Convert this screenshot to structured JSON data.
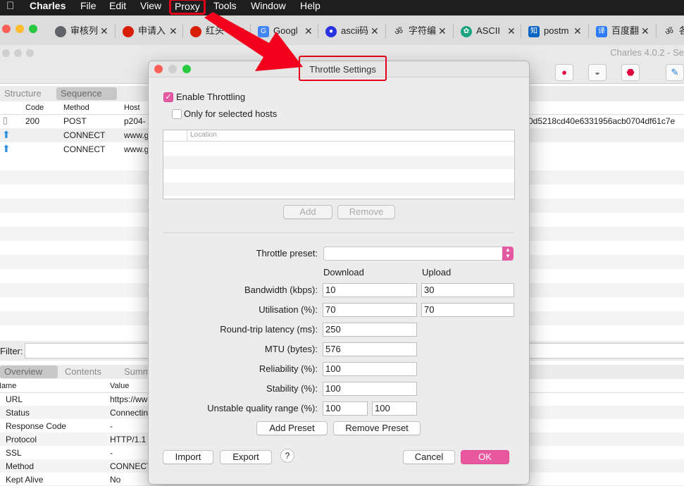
{
  "menubar": {
    "apple": "",
    "app_name": "Charles",
    "items": [
      "File",
      "Edit",
      "View",
      "Proxy",
      "Tools",
      "Window",
      "Help"
    ]
  },
  "browser_tabs": [
    {
      "title": "审核列",
      "icon": "globe-icon"
    },
    {
      "title": "申请入",
      "icon": "red-round-icon"
    },
    {
      "title": "红头",
      "icon": "red-round-icon"
    },
    {
      "title": "Googl",
      "icon": "google-translate-icon"
    },
    {
      "title": "ascii码",
      "icon": "baidu-paw-icon"
    },
    {
      "title": "字符编",
      "icon": "om-icon"
    },
    {
      "title": "ASCII",
      "icon": "openai-icon"
    },
    {
      "title": "postm",
      "icon": "zhihu-icon"
    },
    {
      "title": "百度翻",
      "icon": "fanyi-icon"
    },
    {
      "title": "各",
      "icon": "om-icon"
    }
  ],
  "charles": {
    "title": "Charles 4.0.2 - Se",
    "view_tabs": [
      "Structure",
      "Sequence"
    ],
    "seq_columns": [
      "Code",
      "Method",
      "Host"
    ],
    "seq_rows": [
      {
        "code": "200",
        "method": "POST",
        "host": "p204-",
        "extra": "0d5218cd40e6331956acb0704df61c7e"
      },
      {
        "code": "",
        "method": "CONNECT",
        "host": "www.g",
        "extra": ""
      },
      {
        "code": "",
        "method": "CONNECT",
        "host": "www.g",
        "extra": ""
      }
    ],
    "filter_label": "Filter:",
    "bottom_tabs": [
      "Overview",
      "Contents",
      "Summ"
    ],
    "info_columns": [
      "Name",
      "Value"
    ],
    "info_rows": [
      {
        "name": "URL",
        "value": "https://ww"
      },
      {
        "name": "Status",
        "value": "Connectin"
      },
      {
        "name": "Response Code",
        "value": "-"
      },
      {
        "name": "Protocol",
        "value": "HTTP/1.1"
      },
      {
        "name": "SSL",
        "value": "-"
      },
      {
        "name": "Method",
        "value": "CONNECT"
      },
      {
        "name": "Kept Alive",
        "value": "No"
      }
    ]
  },
  "dialog": {
    "title": "Throttle Settings",
    "enable_throttling": {
      "label": "Enable Throttling",
      "checked": true
    },
    "only_selected_hosts": {
      "label": "Only for selected hosts",
      "checked": false
    },
    "location_header": "Location",
    "add_label": "Add",
    "remove_label": "Remove",
    "preset_label": "Throttle preset:",
    "preset_value": "",
    "download_header": "Download",
    "upload_header": "Upload",
    "bandwidth": {
      "label": "Bandwidth (kbps):",
      "download": "10",
      "upload": "30"
    },
    "utilisation": {
      "label": "Utilisation (%):",
      "download": "70",
      "upload": "70"
    },
    "latency": {
      "label": "Round-trip latency (ms):",
      "value": "250"
    },
    "mtu": {
      "label": "MTU (bytes):",
      "value": "576"
    },
    "reliability": {
      "label": "Reliability (%):",
      "value": "100"
    },
    "stability": {
      "label": "Stability (%):",
      "value": "100"
    },
    "unstable_range": {
      "label": "Unstable quality range (%):",
      "min": "100",
      "max": "100"
    },
    "add_preset_label": "Add Preset",
    "remove_preset_label": "Remove Preset",
    "import_label": "Import",
    "export_label": "Export",
    "help_label": "?",
    "cancel_label": "Cancel",
    "ok_label": "OK"
  },
  "colors": {
    "accent": "#ea59a0",
    "highlight": "#e3001b"
  }
}
